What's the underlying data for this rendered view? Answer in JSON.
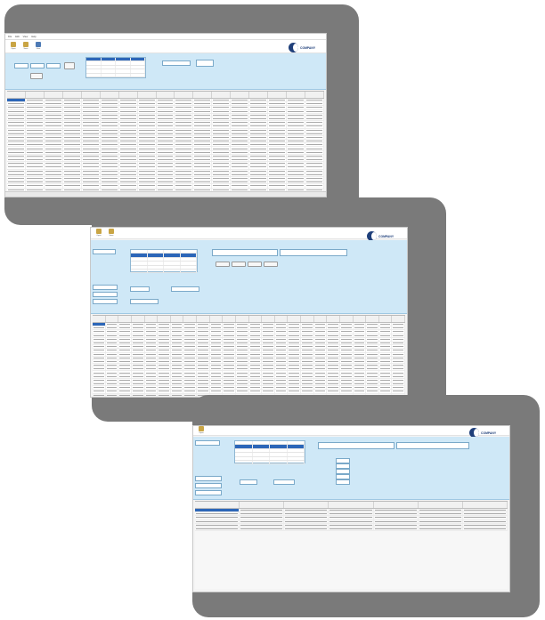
{
  "windows": [
    {
      "id": "window-1",
      "menu": [
        "File",
        "Edit",
        "View",
        "Help"
      ],
      "toolbar": [
        {
          "icon": "folder-icon",
          "label": "Open"
        },
        {
          "icon": "save-icon",
          "label": "Save"
        },
        {
          "icon": "user-icon",
          "label": "User"
        }
      ],
      "logo_text": "COMPANY",
      "grid_columns": 17,
      "grid_rows": 34
    },
    {
      "id": "window-2",
      "toolbar": [
        {
          "icon": "folder-icon",
          "label": "Open"
        },
        {
          "icon": "save-icon",
          "label": "Save"
        }
      ],
      "logo_text": "COMPANY",
      "grid_columns": 24,
      "grid_rows": 28
    },
    {
      "id": "window-3",
      "toolbar": [
        {
          "icon": "folder-icon",
          "label": "Open"
        }
      ],
      "logo_text": "COMPANY",
      "grid_columns": 7,
      "grid_rows": 6
    }
  ],
  "colors": {
    "frame": "#7a7a7a",
    "panel": "#cfe8f7",
    "selection": "#2c66b8",
    "logo": "#1f3f7a"
  }
}
